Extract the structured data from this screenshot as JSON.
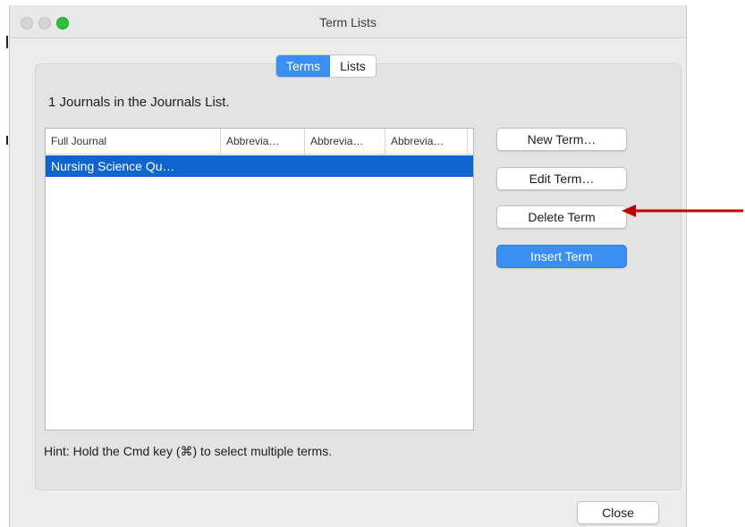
{
  "window": {
    "title": "Term Lists"
  },
  "tabs": {
    "terms": "Terms",
    "lists": "Lists"
  },
  "summary": "1 Journals in the Journals List.",
  "table": {
    "columns": [
      "Full Journal",
      "Abbrevia…",
      "Abbrevia…",
      "Abbrevia…"
    ],
    "rows": [
      {
        "cells": [
          "Nursing Science Qu…",
          "",
          "",
          ""
        ],
        "selected": true
      }
    ]
  },
  "buttons": {
    "new_term": "New Term…",
    "edit_term": "Edit Term…",
    "delete_term": "Delete Term",
    "insert_term": "Insert Term",
    "close": "Close"
  },
  "hint": "Hint: Hold the Cmd key (⌘) to select multiple terms.",
  "annotation": {
    "color": "#c00000",
    "points_to": "delete-term-button"
  },
  "colors": {
    "accent": "#3b8ff3",
    "selection": "#0f64d2"
  }
}
